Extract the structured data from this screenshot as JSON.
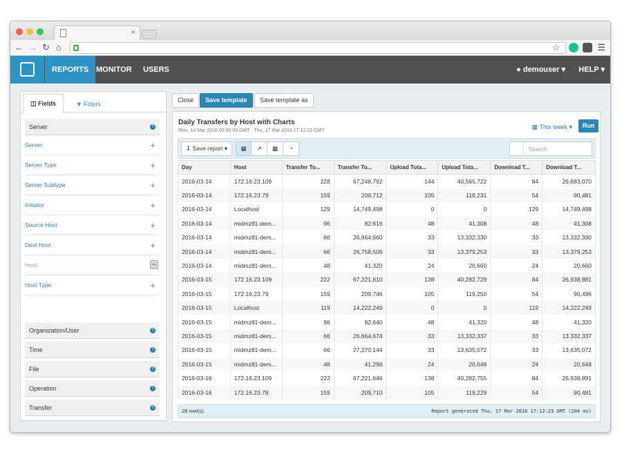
{
  "browser": {
    "tab_close": "×"
  },
  "app": {
    "nav": {
      "reports": "REPORTS",
      "monitor": "MONITOR",
      "users": "USERS"
    },
    "user": "demouser",
    "help": "HELP"
  },
  "sidebar": {
    "tabs": {
      "fields": "Fields",
      "filters": "Filters"
    },
    "server_group": "Server",
    "fields": [
      "Server",
      "Server Type",
      "Server Subtype",
      "Initiator",
      "Source Host",
      "Dest Host",
      "Host",
      "Host Type"
    ],
    "groups": [
      "Organization/User",
      "Time",
      "File",
      "Operation",
      "Transfer"
    ]
  },
  "actions": {
    "close": "Close",
    "save_template": "Save template",
    "save_template_as": "Save template as"
  },
  "report": {
    "title": "Daily Transfers by Host with Charts",
    "subtitle": "Mon, 14 Mar 2016 00:00:00 GMT - Thu, 17 Mar 2016 17:12:23 GMT",
    "period": "This week",
    "run": "Run",
    "save_report": "Save report",
    "search_placeholder": "Search",
    "columns": [
      "Day",
      "Host",
      "Transfer To...",
      "Transfer To...",
      "Upload Tota...",
      "Upload Tota...",
      "Download T...",
      "Download T..."
    ],
    "rows": [
      [
        "2016-03-14",
        "172.16.23.109",
        "228",
        "67,248,792",
        "144",
        "40,565,722",
        "84",
        "26,683,070"
      ],
      [
        "2016-03-14",
        "172.16.23.79",
        "159",
        "209,712",
        "105",
        "119,231",
        "54",
        "90,481"
      ],
      [
        "2016-03-14",
        "Localhost",
        "129",
        "14,749,498",
        "0",
        "0",
        "129",
        "14,749,498"
      ],
      [
        "2016-03-14",
        "midmz81-dem...",
        "96",
        "82,616",
        "48",
        "41,308",
        "48",
        "41,308"
      ],
      [
        "2016-03-14",
        "midmz81-dem...",
        "66",
        "26,664,660",
        "33",
        "13,332,330",
        "33",
        "13,332,330"
      ],
      [
        "2016-03-14",
        "midmz81-dem...",
        "66",
        "26,758,506",
        "33",
        "13,379,253",
        "33",
        "13,379,253"
      ],
      [
        "2016-03-14",
        "midmz81-dem...",
        "48",
        "41,320",
        "24",
        "20,660",
        "24",
        "20,660"
      ],
      [
        "2016-03-15",
        "172.16.23.109",
        "222",
        "67,221,610",
        "138",
        "40,282,729",
        "84",
        "26,938,881"
      ],
      [
        "2016-03-15",
        "172.16.23.79",
        "159",
        "209,746",
        "105",
        "119,250",
        "54",
        "90,496"
      ],
      [
        "2016-03-15",
        "Localhost",
        "119",
        "14,222,249",
        "0",
        "0",
        "119",
        "14,222,249"
      ],
      [
        "2016-03-15",
        "midmz81-dem...",
        "96",
        "82,640",
        "48",
        "41,320",
        "48",
        "41,320"
      ],
      [
        "2016-03-15",
        "midmz81-dem...",
        "66",
        "26,664,674",
        "33",
        "13,332,337",
        "33",
        "13,332,337"
      ],
      [
        "2016-03-15",
        "midmz81-dem...",
        "66",
        "27,270,144",
        "33",
        "13,635,072",
        "33",
        "13,635,072"
      ],
      [
        "2016-03-15",
        "midmz81-dem...",
        "48",
        "41,296",
        "24",
        "20,648",
        "24",
        "20,648"
      ],
      [
        "2016-03-16",
        "172.16.23.109",
        "222",
        "67,221,646",
        "138",
        "40,282,755",
        "84",
        "26,938,891"
      ],
      [
        "2016-03-16",
        "172.16.23.79",
        "159",
        "209,710",
        "105",
        "119,229",
        "54",
        "90,481"
      ]
    ],
    "row_count": "28 row(s).",
    "generated": "Report generated Thu, 17 Mar 2016 17:12:23 GMT (204 ms)"
  }
}
